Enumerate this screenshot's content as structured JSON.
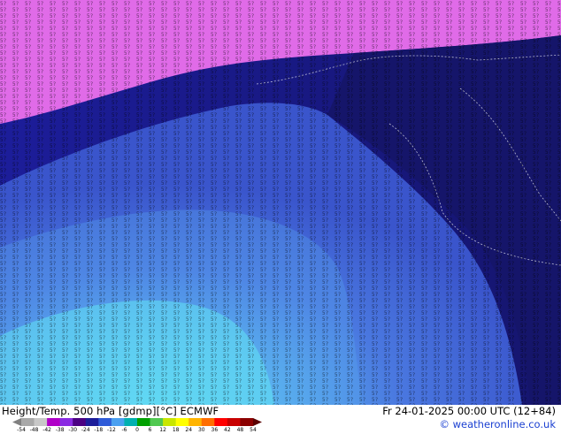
{
  "map": {
    "palette": {
      "magenta": "#e06be8",
      "dark_navy": "#14146e",
      "navy": "#1c1d9a",
      "mid_blue": "#3545c8",
      "blue": "#4a6bde",
      "light_blue": "#5aa2ee",
      "cyan": "#63e4f4",
      "annotation_text": "#000000"
    }
  },
  "legend": {
    "caption": "Height/Temp. 500 hPa [gdmp][°C] ECMWF",
    "datetime": "Fr 24-01-2025 00:00 UTC (12+84)",
    "credit": "© weatheronline.co.uk",
    "ticks": [
      "-54",
      "-48",
      "-42",
      "-38",
      "-30",
      "-24",
      "-18",
      "-12",
      "-6",
      "0",
      "6",
      "12",
      "18",
      "24",
      "30",
      "36",
      "42",
      "48",
      "54"
    ],
    "colors": [
      "#a9a9a9",
      "#c8c8c8",
      "#b000c8",
      "#8a2be2",
      "#4b0082",
      "#1c1d9a",
      "#2e5bd8",
      "#4aa0f0",
      "#00b0b0",
      "#00a000",
      "#50c850",
      "#c8e600",
      "#ffff00",
      "#ffb400",
      "#ff6e00",
      "#ff0000",
      "#c80000",
      "#8b0000"
    ]
  }
}
